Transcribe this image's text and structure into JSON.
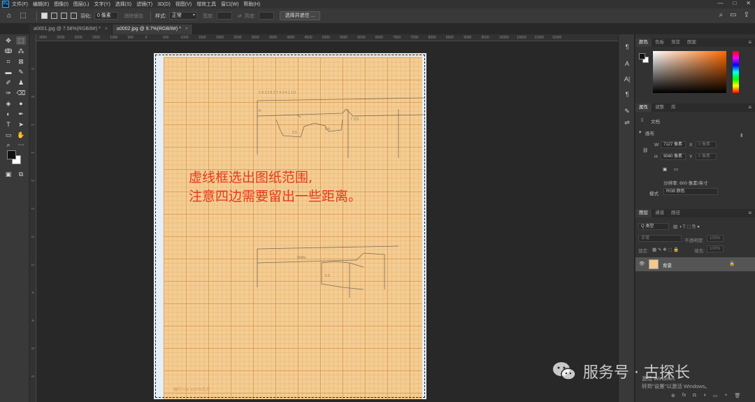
{
  "menu": {
    "logo": "Ps",
    "items": [
      "文件(F)",
      "编辑(E)",
      "图像(I)",
      "图层(L)",
      "文字(Y)",
      "选择(S)",
      "滤镜(T)",
      "3D(D)",
      "视图(V)",
      "增效工具",
      "窗口(W)",
      "帮助(H)"
    ]
  },
  "window_controls": [
    "—",
    "□",
    "✕"
  ],
  "options": {
    "feather_label": "羽化:",
    "feather_value": "0 像素",
    "antialias_label": "消除锯齿",
    "style_label": "样式:",
    "style_value": "正常",
    "width_label": "宽度:",
    "height_label": "高度:",
    "select_mask_button": "选择并遮住 ..."
  },
  "tabs": [
    {
      "label": "a0001.jpg @ 7.58%(RGB/8#) *",
      "close": "×"
    },
    {
      "label": "a0002.jpg @ 9.7%(RGB/8#) *",
      "close": "×"
    }
  ],
  "ruler_h_ticks": [
    "3000",
    "2500",
    "2000",
    "1500",
    "1000",
    "500",
    "0",
    "500",
    "1000",
    "1500",
    "2000",
    "2500",
    "3000",
    "3500",
    "4000",
    "4500",
    "5000",
    "5500",
    "6000",
    "6500",
    "7000",
    "7500",
    "8000",
    "8500",
    "9000",
    "9500",
    "10000",
    "10500",
    "11000",
    "11500"
  ],
  "ruler_v_ticks": [
    "0",
    "5",
    "1",
    "1",
    "2",
    "2",
    "3",
    "3",
    "4",
    "4",
    "5",
    "5"
  ],
  "annotation": {
    "line1": "虚线框选出图纸范围,",
    "line2": "注意四边需要留出一些距离。"
  },
  "doc_footer": "编号?04        333?8克克",
  "panels": {
    "color_tabs": [
      "颜色",
      "色板",
      "渐变",
      "图案"
    ],
    "properties_tabs": [
      "属性",
      "调整",
      "库"
    ],
    "doc_label": "文档",
    "canvas_section": "画布",
    "w_label": "W",
    "w_value": "7127 像素",
    "x_label": "X",
    "x_value": "0 像素",
    "h_label": "H",
    "h_value": "9040 像素",
    "y_label": "Y",
    "y_value": "0 像素",
    "resolution": "分辨率: 600 像素/英寸",
    "mode_label": "模式",
    "mode_value": "RGB 颜色",
    "layers_tabs": [
      "图层",
      "通道",
      "路径"
    ],
    "layer_filter": "Q 类型",
    "blend_mode": "正常",
    "opacity_label": "不透明度:",
    "opacity_value": "100%",
    "lock_label": "锁定:",
    "fill_label": "填充:",
    "fill_value": "100%",
    "layer_name": "背景"
  },
  "watermark": "服务号 · 古探长",
  "activate_windows": {
    "line1": "激活 Windows",
    "line2": "转到\"设置\"以激活 Windows。"
  },
  "bottom_icons": [
    "⊕",
    "fx",
    "◘",
    "◑",
    "▭",
    "+",
    "🗑"
  ],
  "colors": {
    "accent_annotation": "#e8391d",
    "paper": "#f3c98e",
    "ps_blue": "#31a8ff"
  }
}
